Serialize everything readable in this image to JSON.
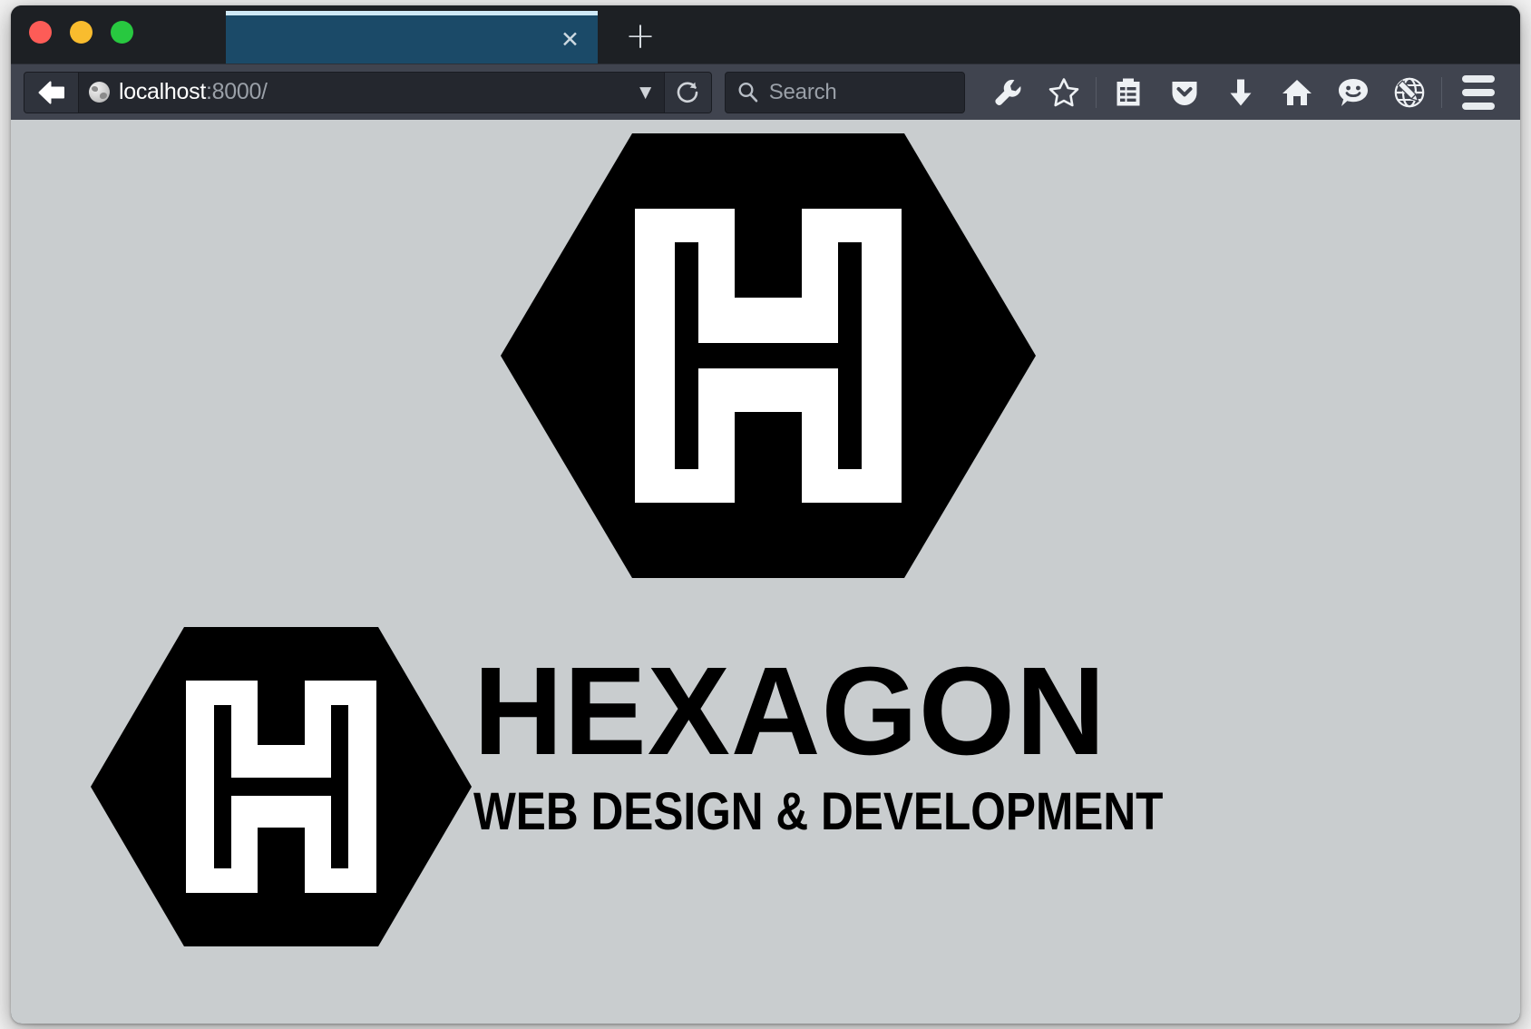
{
  "window": {
    "traffic_lights": [
      {
        "name": "close",
        "color": "#fd5c57"
      },
      {
        "name": "minimize",
        "color": "#f9bc2e"
      },
      {
        "name": "zoom",
        "color": "#28c840"
      }
    ]
  },
  "tabs": {
    "active": {
      "title": "",
      "close_label": "✕",
      "accent_color": "#cfe9f7",
      "background_color": "#1b4a68"
    },
    "new_tab_label": "+"
  },
  "toolbar": {
    "back_icon": "back-arrow-icon",
    "site_icon": "globe-favicon-icon",
    "url": {
      "host": "localhost",
      "port_path": ":8000/"
    },
    "dropdown_label": "▼",
    "reload_icon": "reload-icon",
    "search": {
      "placeholder": "Search",
      "icon": "search-icon"
    },
    "icons": [
      {
        "name": "wrench-icon",
        "label": "Developer Tools"
      },
      {
        "name": "star-icon",
        "label": "Bookmark this page"
      },
      {
        "name": "reader-list-icon",
        "label": "Show your bookmarks"
      },
      {
        "name": "pocket-icon",
        "label": "Save to Pocket"
      },
      {
        "name": "download-arrow-icon",
        "label": "Downloads"
      },
      {
        "name": "home-icon",
        "label": "Home"
      },
      {
        "name": "smiley-icon",
        "label": "Submit feedback"
      },
      {
        "name": "globe-pencil-icon",
        "label": "Web Developer"
      }
    ],
    "menu_label": "Open menu"
  },
  "page": {
    "background_color": "#c9cdcf",
    "logo": {
      "shape": "hexagon",
      "letter": "H",
      "fill_color": "#000000",
      "letter_color": "#ffffff"
    },
    "brand_name": "HEXAGON",
    "brand_tagline": "WEB DESIGN & DEVELOPMENT"
  }
}
